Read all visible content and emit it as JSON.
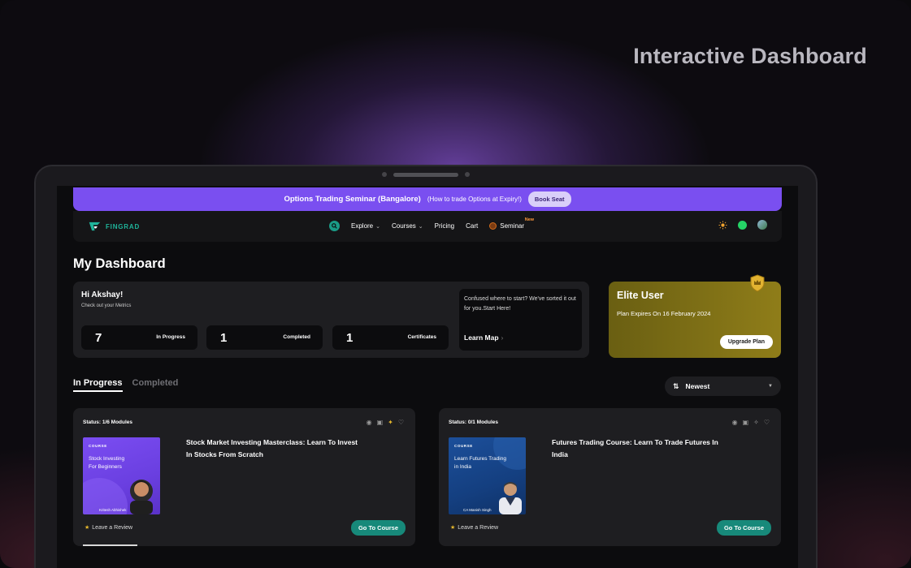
{
  "headline": "Interactive Dashboard",
  "banner": {
    "title": "Options Trading Seminar (Bangalore)",
    "subtitle": "(How to trade Options at Expiry!)",
    "button": "Book Seat"
  },
  "nav": {
    "brand": "FINGRAD",
    "items": [
      {
        "label": "Explore",
        "has_dropdown": true
      },
      {
        "label": "Courses",
        "has_dropdown": true
      },
      {
        "label": "Pricing",
        "has_dropdown": false
      },
      {
        "label": "Cart",
        "has_dropdown": false
      }
    ],
    "seminar": "Seminar",
    "new_badge": "New"
  },
  "dashboard": {
    "title": "My Dashboard",
    "greeting": "Hi Akshay!",
    "greeting_sub": "Check out your Metrics",
    "stats": [
      {
        "value": "7",
        "label": "In Progress"
      },
      {
        "value": "1",
        "label": "Completed"
      },
      {
        "value": "1",
        "label": "Certificates"
      }
    ],
    "learn_map": {
      "text": "Confused where to start? We've sorted it out for you.Start Here!",
      "link": "Learn Map",
      "arrow": "›"
    }
  },
  "elite": {
    "title": "Elite User",
    "subtitle": "Plan Expires On 16 February 2024",
    "button": "Upgrade Plan"
  },
  "tabs": [
    {
      "label": "In Progress",
      "active": true
    },
    {
      "label": "Completed",
      "active": false
    }
  ],
  "sort": {
    "label": "Newest"
  },
  "courses": [
    {
      "status": "Status: 1/6 Modules",
      "thumb_tag": "COURSE",
      "thumb_title_1": "Stock Investing",
      "thumb_title_2": "For Beginners",
      "thumb_author": "Kritesh Abhishek",
      "title": "Stock Market Investing Masterclass: Learn To Invest In Stocks From Scratch",
      "review": "Leave a Review",
      "button": "Go To Course",
      "pinned": true
    },
    {
      "status": "Status: 0/1 Modules",
      "thumb_tag": "COURSE",
      "thumb_title_1": "Learn Futures Trading",
      "thumb_title_2": "in India",
      "thumb_author": "CA Manish Singh",
      "title": "Futures Trading Course: Learn To Trade Futures In India",
      "review": "Leave a Review",
      "button": "Go To Course",
      "pinned": false
    }
  ],
  "colors": {
    "banner": "#7a4ff0",
    "accent_teal": "#17897a",
    "elite_gold": "#8f7d19",
    "card_bg": "#1e1e21"
  }
}
